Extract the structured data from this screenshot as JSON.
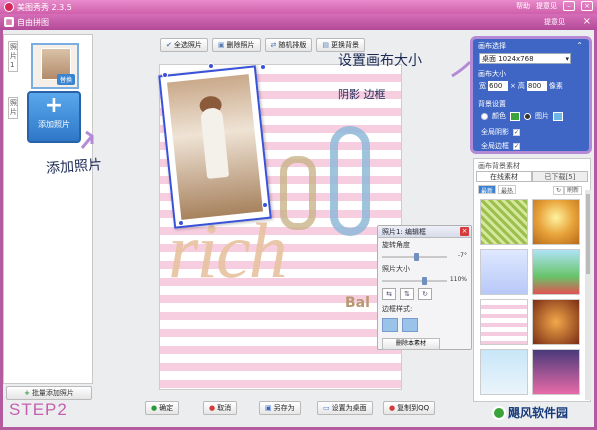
{
  "window": {
    "app_title": "美图秀秀 2.3.5",
    "help_link": "帮助",
    "feedback_link": "提意见"
  },
  "module": {
    "title": "自由拼图",
    "feedback": "提意见"
  },
  "left": {
    "thumb_label": "照片1",
    "replace_badge": "替换",
    "photo_label_2": "照片",
    "add_label": "添加照片",
    "batch_label": "批量添加照片"
  },
  "toolbar": {
    "select_all": "全选照片",
    "delete": "删除照片",
    "random": "随机排版",
    "change_bg": "更换背景"
  },
  "canvas": {
    "big_text": "rich",
    "small_text": "Bal"
  },
  "popup": {
    "title": "照片1: 编辑框",
    "rotate_label": "旋转角度",
    "rotate_value": "-7°",
    "size_label": "照片大小",
    "size_value": "110%",
    "border_label": "边框样式:",
    "delete_material": "删除本素材"
  },
  "settings": {
    "canvas_select_label": "画布选择",
    "canvas_value": "桌面 1024x768",
    "canvas_size_label": "画布大小",
    "width_label": "宽",
    "width_value": "600",
    "height_label": "高",
    "height_value": "800",
    "unit": "像素",
    "bg_setting_label": "背景设置",
    "color_label": "颜色",
    "image_label": "图片",
    "global_shadow": "全局阴影",
    "global_border": "全局边框"
  },
  "materials": {
    "title": "画布背景素材",
    "tab_online": "在线素材",
    "tab_downloaded": "已下载[5]",
    "sub_latest": "最新",
    "sub_hot": "最热",
    "refresh": "刷新"
  },
  "bottom": {
    "ok": "确定",
    "cancel": "取消",
    "save_as": "另存为",
    "set_wallpaper": "设置为桌面",
    "copy_qq": "复制到QQ"
  },
  "annotations": {
    "set_canvas_size": "设置画布大小",
    "shadow_border": "阴影 边框",
    "add_photo": "添加照片",
    "step": "STEP2"
  },
  "brand": {
    "name": "飓风软件园"
  }
}
